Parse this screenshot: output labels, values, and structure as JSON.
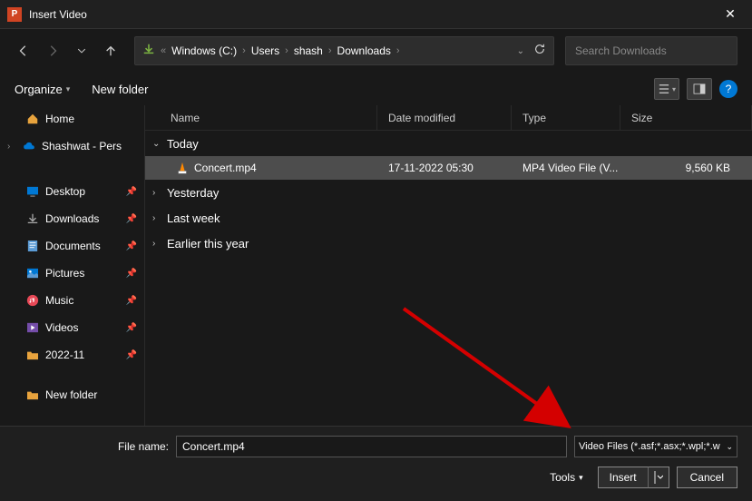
{
  "titlebar": {
    "icon_letter": "P",
    "title": "Insert Video"
  },
  "nav": {
    "breadcrumb": [
      "Windows (C:)",
      "Users",
      "shash",
      "Downloads"
    ],
    "prefix": "«",
    "search_placeholder": "Search Downloads"
  },
  "toolbar": {
    "organize": "Organize",
    "newfolder": "New folder"
  },
  "sidebar": {
    "home": "Home",
    "onedrive": "Shashwat - Pers",
    "quick": [
      "Desktop",
      "Downloads",
      "Documents",
      "Pictures",
      "Music",
      "Videos",
      "2022-11"
    ],
    "newfolder": "New folder"
  },
  "columns": {
    "name": "Name",
    "date": "Date modified",
    "type": "Type",
    "size": "Size"
  },
  "groups": {
    "today": "Today",
    "yesterday": "Yesterday",
    "lastweek": "Last week",
    "earlier": "Earlier this year"
  },
  "files": {
    "today": [
      {
        "name": "Concert.mp4",
        "date": "17-11-2022 05:30",
        "type": "MP4 Video File (V...",
        "size": "9,560 KB"
      }
    ]
  },
  "footer": {
    "filename_label": "File name:",
    "filename_value": "Concert.mp4",
    "filter": "Video Files (*.asf;*.asx;*.wpl;*.w",
    "tools": "Tools",
    "insert": "Insert",
    "cancel": "Cancel"
  }
}
